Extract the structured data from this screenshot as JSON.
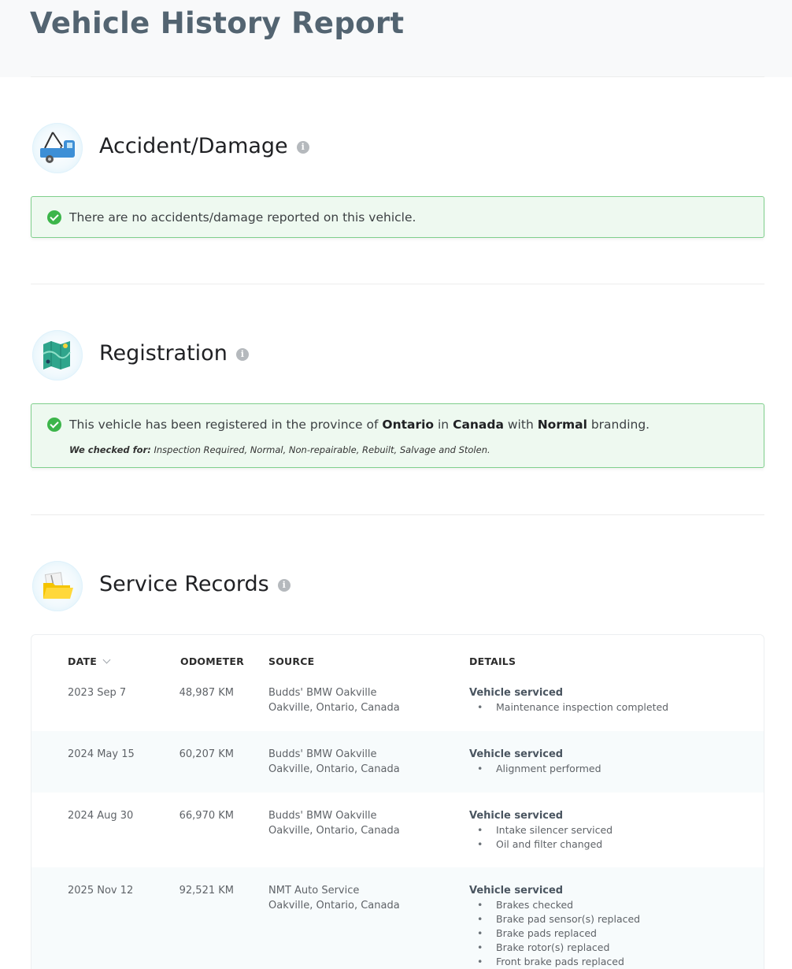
{
  "page": {
    "title": "Vehicle History Report"
  },
  "accident": {
    "title": "Accident/Damage",
    "message": "There are no accidents/damage reported on this vehicle."
  },
  "registration": {
    "title": "Registration",
    "msg_pre": "This vehicle has been registered in the province of ",
    "province": "Ontario",
    "msg_in": " in ",
    "country": "Canada",
    "msg_with": " with ",
    "branding": "Normal",
    "msg_post": " branding.",
    "checked_label": "We checked for:",
    "checked_items": " Inspection Required, Normal, Non-repairable, Rebuilt, Salvage and Stolen."
  },
  "service": {
    "title": "Service Records",
    "headers": {
      "date": "DATE",
      "odometer": "ODOMETER",
      "source": "SOURCE",
      "details": "DETAILS"
    },
    "rows": [
      {
        "date": "2023 Sep 7",
        "odometer": "48,987 KM",
        "source_name": "Budds' BMW Oakville",
        "source_loc": "Oakville, Ontario, Canada",
        "detail_title": "Vehicle serviced",
        "items": [
          "Maintenance inspection completed"
        ]
      },
      {
        "date": "2024 May 15",
        "odometer": "60,207 KM",
        "source_name": "Budds' BMW Oakville",
        "source_loc": "Oakville, Ontario, Canada",
        "detail_title": "Vehicle serviced",
        "items": [
          "Alignment performed"
        ]
      },
      {
        "date": "2024 Aug 30",
        "odometer": "66,970 KM",
        "source_name": "Budds' BMW Oakville",
        "source_loc": "Oakville, Ontario, Canada",
        "detail_title": "Vehicle serviced",
        "items": [
          "Intake silencer serviced",
          "Oil and filter changed"
        ]
      },
      {
        "date": "2025 Nov 12",
        "odometer": "92,521 KM",
        "source_name": "NMT Auto Service",
        "source_loc": "Oakville, Ontario, Canada",
        "detail_title": "Vehicle serviced",
        "items": [
          "Brakes checked",
          "Brake pad sensor(s) replaced",
          "Brake pads replaced",
          "Brake rotor(s) replaced",
          "Front brake pads replaced"
        ]
      }
    ]
  }
}
